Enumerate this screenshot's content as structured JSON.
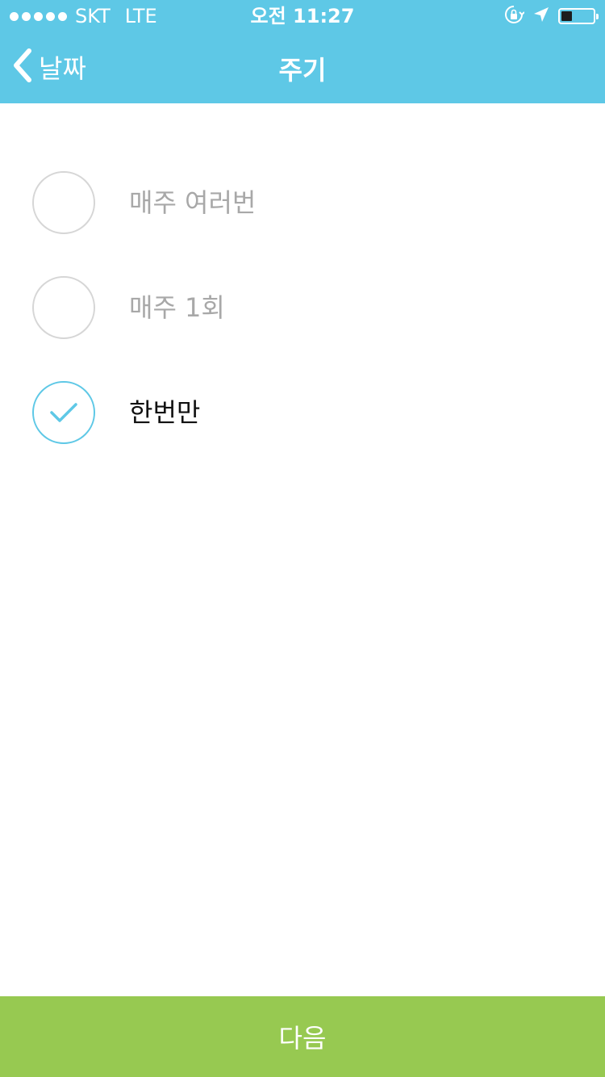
{
  "status_bar": {
    "carrier": "SKT",
    "network": "LTE",
    "time": "오전 11:27",
    "battery_level": 0.35,
    "icons": [
      "signal-dots-icon",
      "rotation-lock-icon",
      "location-arrow-icon",
      "battery-icon"
    ]
  },
  "nav": {
    "back_label": "날짜",
    "title": "주기",
    "back_icon": "chevron-left-icon"
  },
  "options": [
    {
      "label": "매주 여러번",
      "selected": false
    },
    {
      "label": "매주 1회",
      "selected": false
    },
    {
      "label": "한번만",
      "selected": true
    }
  ],
  "footer": {
    "next_label": "다음"
  },
  "colors": {
    "header_bg": "#5ec8e6",
    "accent": "#5ec8e6",
    "next_button_bg": "#97c951",
    "unselected_text": "#a8a8a8",
    "selected_text": "#111111",
    "radio_border": "#d6d6d6"
  }
}
